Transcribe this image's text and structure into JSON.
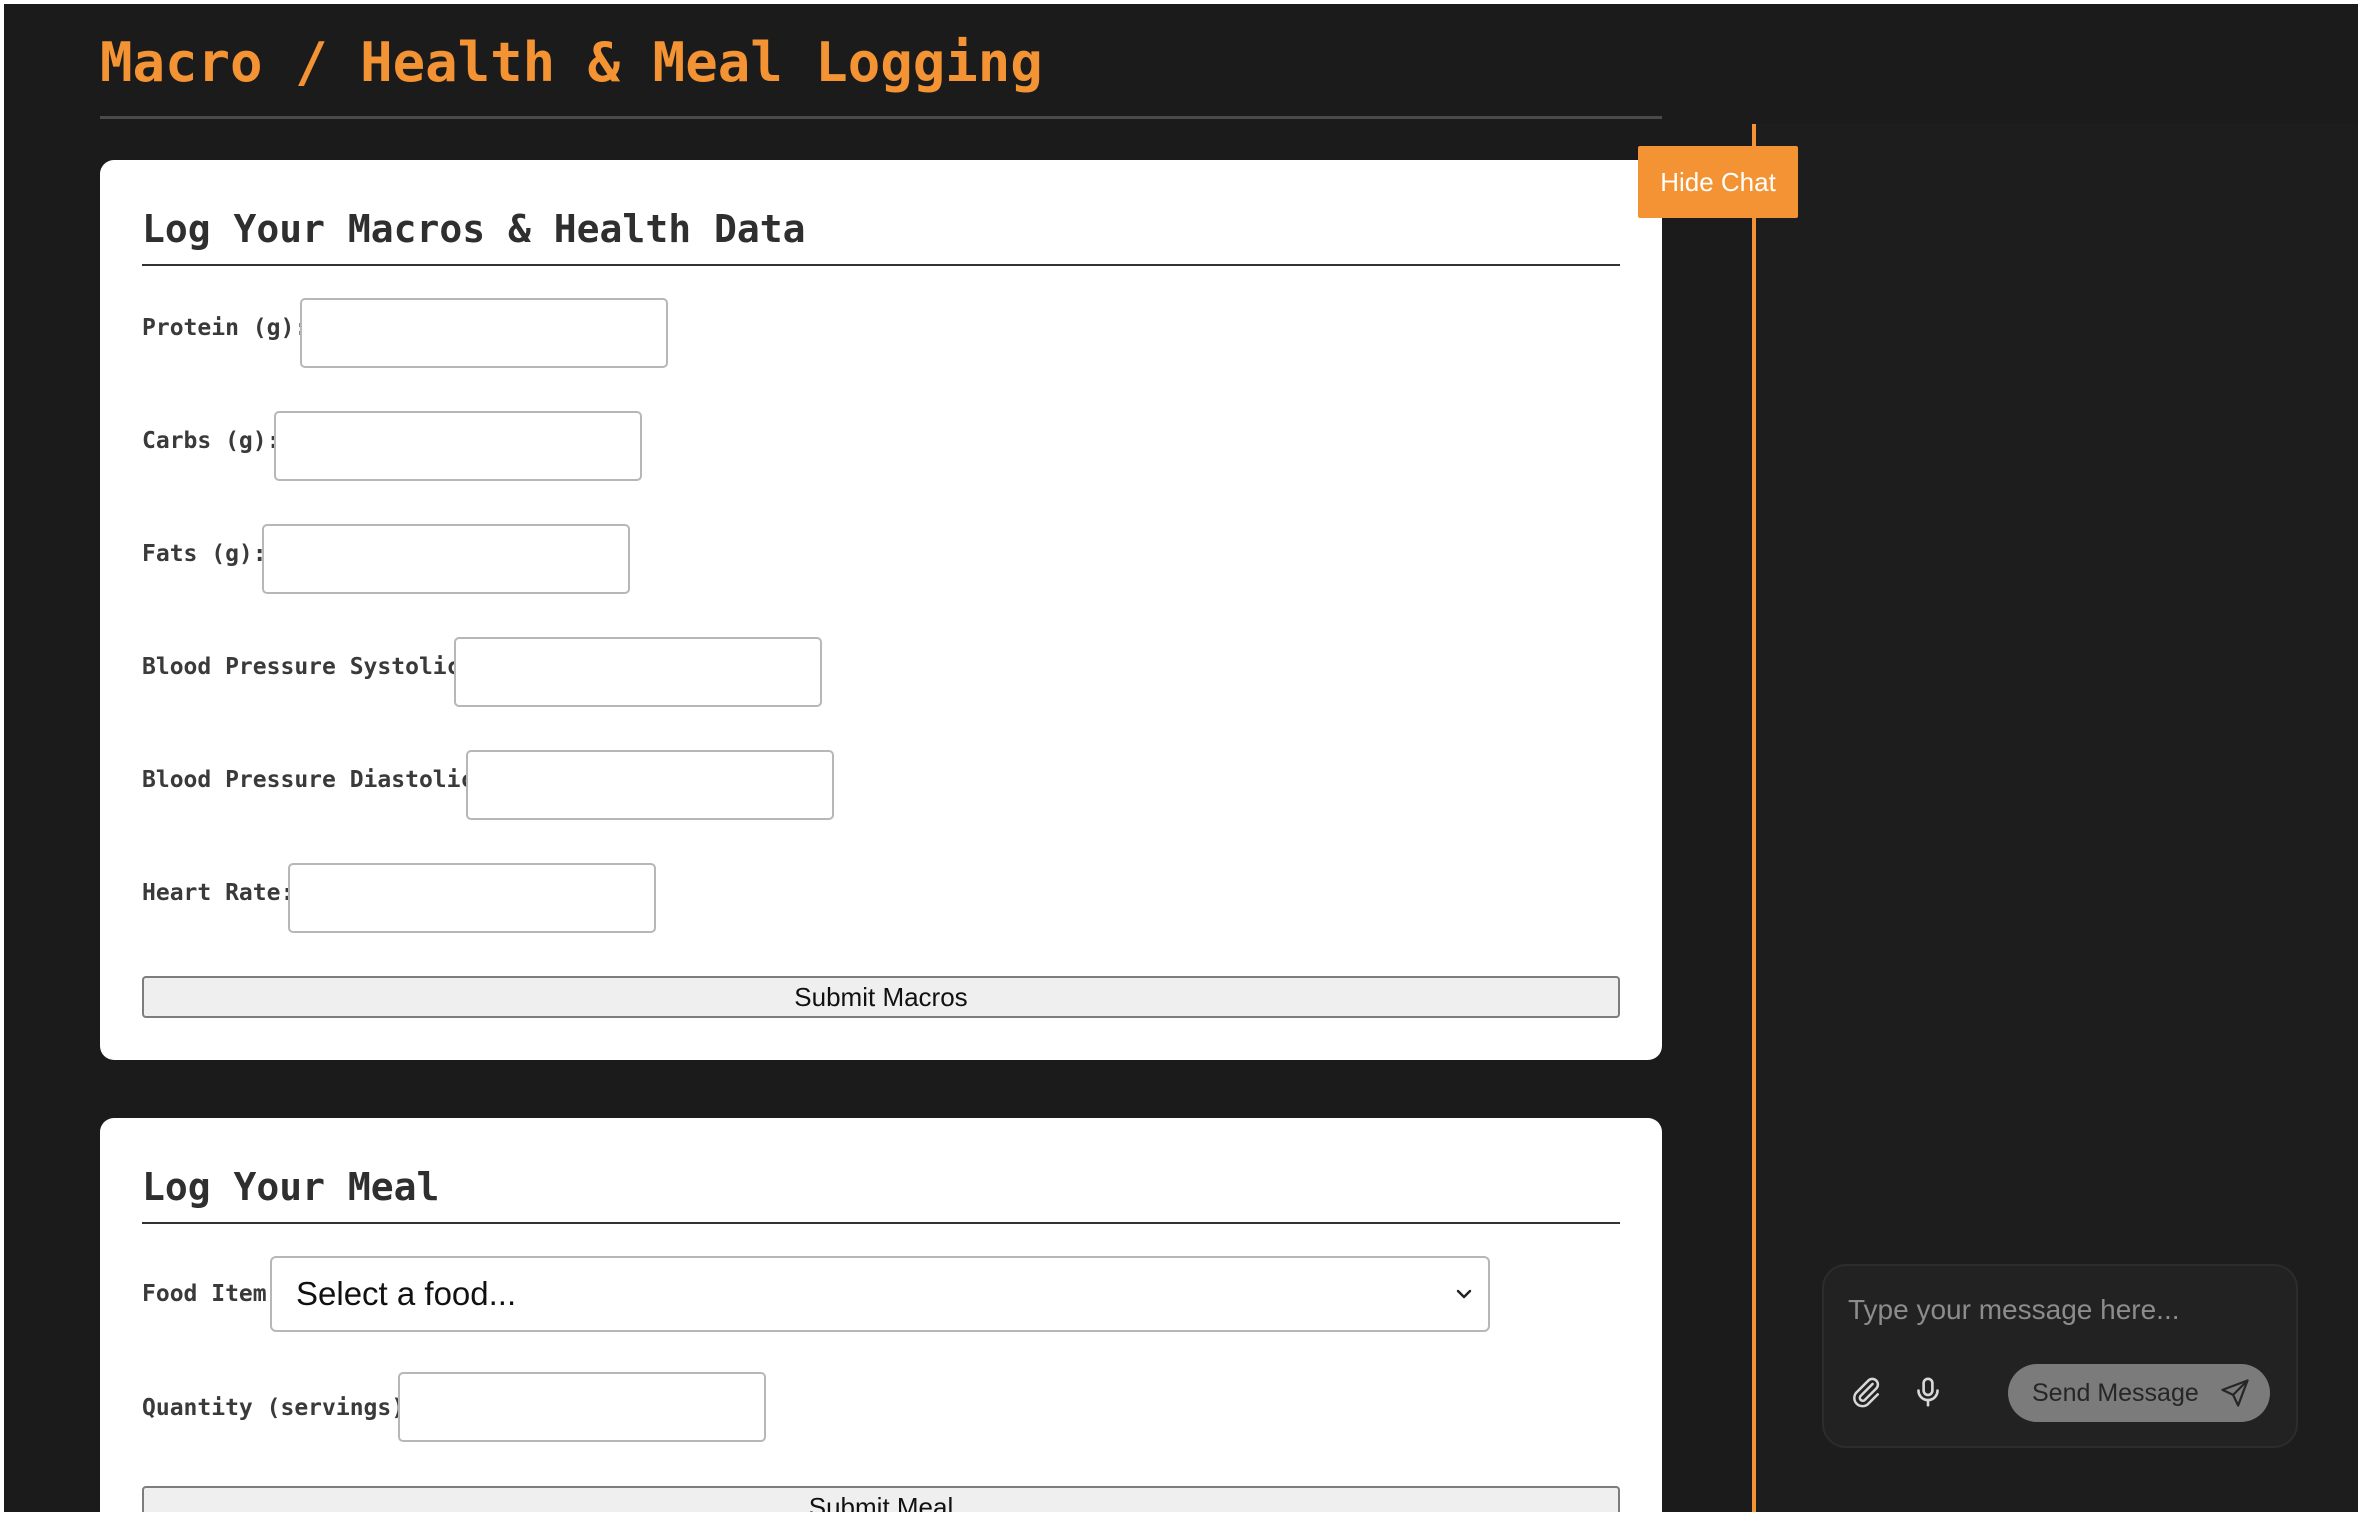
{
  "header": {
    "title": "Macro / Health & Meal Logging"
  },
  "macros_form": {
    "title": "Log Your Macros & Health Data",
    "fields": [
      {
        "label": "Protein (g):",
        "value": ""
      },
      {
        "label": "Carbs (g):",
        "value": ""
      },
      {
        "label": "Fats (g):",
        "value": ""
      },
      {
        "label": "Blood Pressure Systolic:",
        "value": ""
      },
      {
        "label": "Blood Pressure Diastolic:",
        "value": ""
      },
      {
        "label": "Heart Rate:",
        "value": ""
      }
    ],
    "submit_label": "Submit Macros"
  },
  "meal_form": {
    "title": "Log Your Meal",
    "food_label": "Food Item:",
    "food_selected": "Select a food...",
    "quantity_label": "Quantity (servings):",
    "quantity_value": "",
    "submit_label": "Submit Meal"
  },
  "chat": {
    "hide_label": "Hide Chat",
    "input_placeholder": "Type your message here...",
    "send_label": "Send Message",
    "icons": {
      "attach": "paperclip-icon",
      "mic": "microphone-icon",
      "send": "paper-plane-icon"
    }
  },
  "colors": {
    "accent": "#f39333",
    "background": "#1b1b1b",
    "card": "#ffffff"
  }
}
